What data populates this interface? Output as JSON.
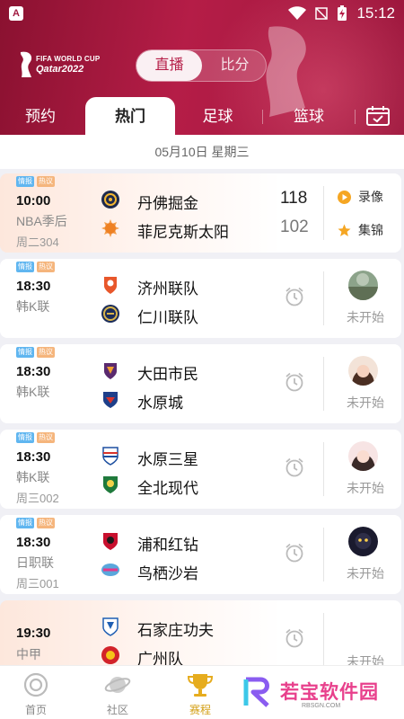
{
  "status_bar": {
    "time": "15:12"
  },
  "header": {
    "logo_line1": "FIFA WORLD CUP",
    "logo_line2": "Qatar2022",
    "segment": {
      "active": "直播",
      "inactive": "比分"
    }
  },
  "tabs": [
    {
      "label": "预约"
    },
    {
      "label": "热门"
    },
    {
      "label": "足球"
    },
    {
      "label": "篮球"
    }
  ],
  "date_bar": {
    "text": "05月10日 星期三"
  },
  "matches": [
    {
      "tags": [
        "情报",
        "热议"
      ],
      "time": "10:00",
      "league": "NBA季后",
      "code": "周二304",
      "team1": "丹佛掘金",
      "team2": "菲尼克斯太阳",
      "score1": "118",
      "score2": "102",
      "actions": [
        "录像",
        "集锦"
      ]
    },
    {
      "tags": [
        "情报",
        "热议"
      ],
      "time": "18:30",
      "league": "韩K联",
      "code": "",
      "team1": "济州联队",
      "team2": "仁川联队",
      "status": "未开始"
    },
    {
      "tags": [
        "情报",
        "热议"
      ],
      "time": "18:30",
      "league": "韩K联",
      "code": "",
      "team1": "大田市民",
      "team2": "水原城",
      "status": "未开始"
    },
    {
      "tags": [
        "情报",
        "热议"
      ],
      "time": "18:30",
      "league": "韩K联",
      "code": "周三002",
      "team1": "水原三星",
      "team2": "全北现代",
      "status": "未开始"
    },
    {
      "tags": [
        "情报",
        "热议"
      ],
      "time": "18:30",
      "league": "日职联",
      "code": "周三001",
      "team1": "浦和红钻",
      "team2": "鸟栖沙岩",
      "status": "未开始"
    },
    {
      "time": "19:30",
      "league": "中甲",
      "team1": "石家庄功夫",
      "team2": "广州队",
      "status": "未开始"
    }
  ],
  "bottom_nav": [
    {
      "label": "首页"
    },
    {
      "label": "社区"
    },
    {
      "label": "赛程"
    }
  ],
  "watermark": {
    "text": "若宝软件园",
    "sub": "RBSGN.COM"
  },
  "colors": {
    "brand": "#b51d47",
    "active_nav": "#d4a017",
    "tag_blue": "#60b6f0",
    "tag_orange": "#f5b57c"
  }
}
